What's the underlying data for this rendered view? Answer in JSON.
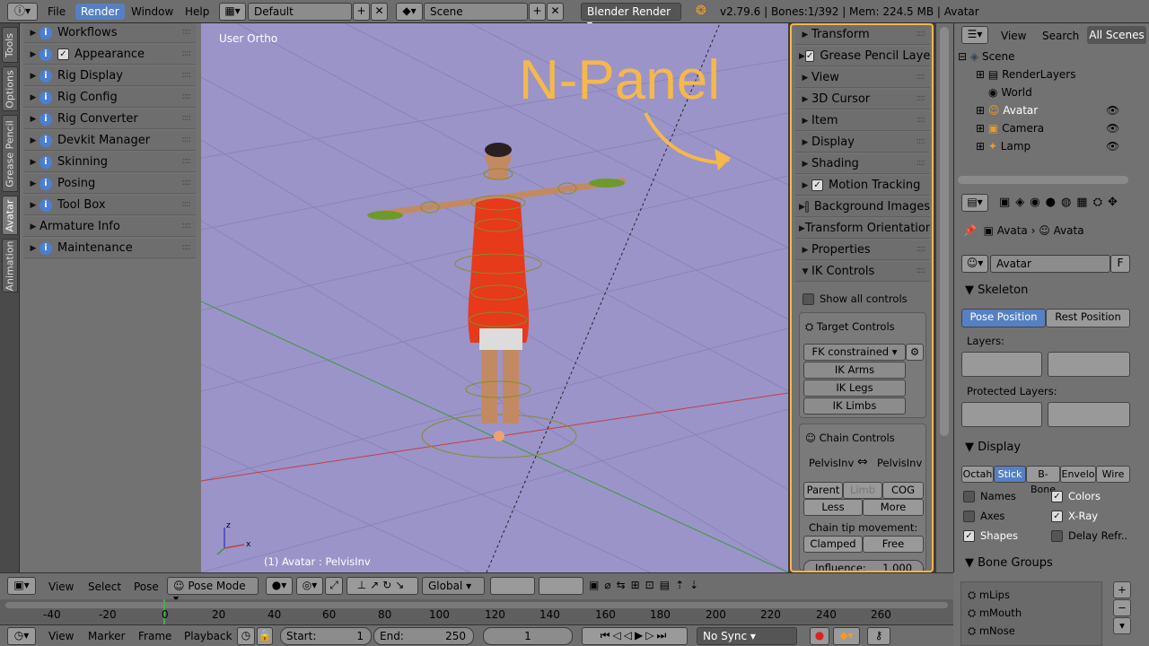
{
  "topbar": {
    "menus": [
      "File",
      "Render",
      "Window",
      "Help"
    ],
    "active_menu": "Render",
    "screen_layout": "Default",
    "scene": "Scene",
    "engine": "Blender Render",
    "stats": "v2.79.6 | Bones:1/392 | Mem: 224.5 MB | Avatar"
  },
  "left_tabs": [
    "Tools",
    "Options",
    "Grease Pencil",
    "Avatar",
    "Animation"
  ],
  "left_panels": [
    {
      "label": "Workflows",
      "icon": "info"
    },
    {
      "label": "Appearance",
      "icon": "info",
      "check": true
    },
    {
      "label": "Rig Display",
      "icon": "info"
    },
    {
      "label": "Rig Config",
      "icon": "info"
    },
    {
      "label": "Rig Converter",
      "icon": "info"
    },
    {
      "label": "Devkit Manager",
      "icon": "info"
    },
    {
      "label": "Skinning",
      "icon": "info"
    },
    {
      "label": "Posing",
      "icon": "info"
    },
    {
      "label": "Tool Box",
      "icon": "info"
    },
    {
      "label": "Armature Info",
      "icon": "none"
    },
    {
      "label": "Maintenance",
      "icon": "info"
    }
  ],
  "viewport": {
    "view_label": "User Ortho",
    "status": "(1) Avatar : PelvisInv",
    "annotation": "N-Panel",
    "annotation_color": "#f5b84a",
    "bg": "#9a94c9"
  },
  "npanel": {
    "sections": [
      "Transform",
      "Grease Pencil Layers",
      "View",
      "3D Cursor",
      "Item",
      "Display",
      "Shading",
      "Motion Tracking",
      "Background Images",
      "Transform Orientations",
      "Properties",
      "IK Controls"
    ],
    "show_all_controls": "Show all controls",
    "target_controls": "Target Controls",
    "fk_constrained": "FK constrained",
    "ik_arms": "IK Arms",
    "ik_legs": "IK Legs",
    "ik_limbs": "IK Limbs",
    "chain_controls": "Chain Controls",
    "chain_from": "PelvisInv",
    "chain_to": "PelvisInv",
    "parent": "Parent",
    "limb": "Limb",
    "cog": "COG",
    "less": "Less",
    "more": "More",
    "chain_tip": "Chain tip movement:",
    "clamped": "Clamped",
    "free": "Free",
    "influence_label": "Influence:",
    "influence_value": "1.000"
  },
  "outliner": {
    "tabs": [
      "View",
      "Search",
      "All Scenes"
    ],
    "items": [
      {
        "label": "Scene",
        "depth": 0
      },
      {
        "label": "RenderLayers",
        "depth": 1
      },
      {
        "label": "World",
        "depth": 1
      },
      {
        "label": "Avatar",
        "depth": 1,
        "highlight": true
      },
      {
        "label": "Camera",
        "depth": 1
      },
      {
        "label": "Lamp",
        "depth": 1
      }
    ]
  },
  "properties": {
    "breadcrumb_a": "Avata",
    "breadcrumb_b": "Avata",
    "datablock": "Avatar",
    "fake_user": "F",
    "skeleton": "Skeleton",
    "pose_position": "Pose Position",
    "rest_position": "Rest Position",
    "layers": "Layers:",
    "protected_layers": "Protected Layers:",
    "display": "Display",
    "display_types": [
      "Octah",
      "Stick",
      "B-Bone",
      "Envelo",
      "Wire"
    ],
    "active_display": "Stick",
    "names": "Names",
    "colors": "Colors",
    "axes": "Axes",
    "xray": "X-Ray",
    "shapes": "Shapes",
    "delay_refresh": "Delay Refr..",
    "bone_groups": "Bone Groups",
    "groups": [
      "mLips",
      "mMouth",
      "mNose"
    ]
  },
  "viewheader": {
    "view": "View",
    "select": "Select",
    "pose": "Pose",
    "mode": "Pose Mode",
    "orientation": "Global"
  },
  "timeline": {
    "ticks": [
      "-40",
      "-20",
      "0",
      "20",
      "40",
      "60",
      "80",
      "100",
      "120",
      "140",
      "160",
      "180",
      "200",
      "220",
      "240",
      "260"
    ]
  },
  "tlheader": {
    "view": "View",
    "marker": "Marker",
    "frame": "Frame",
    "playback": "Playback",
    "start_label": "Start:",
    "start": "1",
    "end_label": "End:",
    "end": "250",
    "current": "1",
    "sync": "No Sync"
  },
  "colors": {
    "accent": "#5680c2",
    "highlight": "#f5b84a",
    "dress": "#e63a1a"
  }
}
